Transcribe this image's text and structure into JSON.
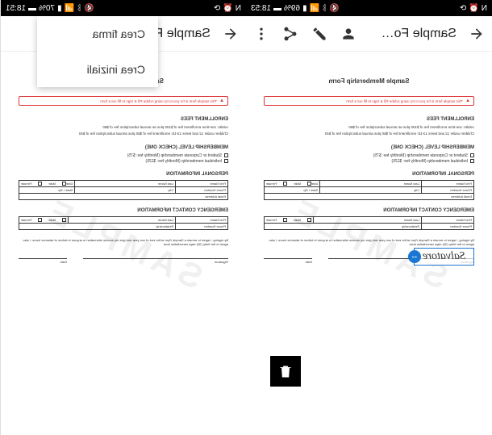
{
  "left": {
    "status": {
      "time": "18:53",
      "battery": "69%",
      "icons": [
        "N",
        "wifi",
        "bt",
        "signal",
        "mute"
      ]
    },
    "appbar": {
      "title": "Sample Fo…"
    },
    "trash_visible": true,
    "signature_text": "Salvatore"
  },
  "right": {
    "status": {
      "time": "18:51",
      "battery": "70%",
      "icons": [
        "N",
        "wifi",
        "bt",
        "signal",
        "mute"
      ]
    },
    "appbar": {
      "title": "Sample Fo…"
    },
    "menu": {
      "item1": "Crea firma",
      "item2": "Crea iniziali"
    }
  },
  "doc": {
    "title": "Sample Membership Form",
    "alert": "This sample form is for you to try using Adobe Fill & Sign to fill out a form",
    "section1_title": "ENROLLMENT FEES",
    "section1_line1": "Adults: one-time enrollment fee of $100 plus an annual subscription fee of $60",
    "section1_line2": "Children under 12 and teens 13-18: enrollment fee of $50 plus annual subscription fee of $40",
    "section2_title": "MEMBERSHIP LEVEL (CHECK ONE)",
    "section2_opt1": "Student or Corporate membership (Monthly fee: $75)",
    "section2_opt2": "Individual membership (Monthly fee: $125)",
    "section3_title": "PERSONAL INFORMATION",
    "section4_title": "EMERGENCY CONTACT INFORMATION",
    "field_firstname": "First Name",
    "field_lastname": "Last Name",
    "field_date": "Date",
    "field_male": "Male",
    "field_female": "Female",
    "field_phone": "Phone Number",
    "field_city": "City",
    "field_state": "State",
    "field_zip": "Zip",
    "field_email": "Email Address",
    "field_relationship": "Relationship",
    "disclaimer": "By signing, I agree to remain a Sample Gym at the end of one year and give my access information to anyone in before of absence hours. I also agree to the thirty (30) days cancellation lead.",
    "sig_label": "Signature",
    "date_label": "Date",
    "watermark": "SAMPLE"
  }
}
